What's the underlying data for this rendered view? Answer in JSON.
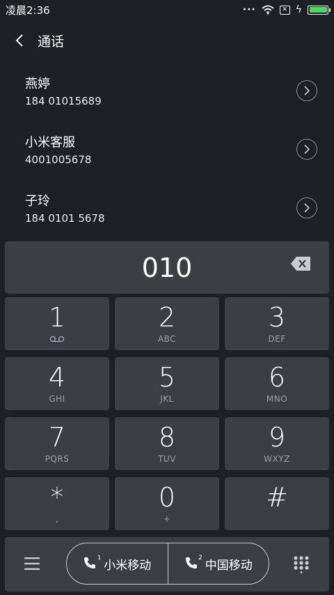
{
  "status": {
    "time": "凌晨2:36",
    "dots": "···",
    "icons": [
      "wifi-icon",
      "sim-disabled-icon",
      "charging-icon",
      "battery-icon"
    ],
    "battery_color": "#4cd964"
  },
  "header": {
    "title": "通话"
  },
  "contacts": [
    {
      "name": "燕婷",
      "number": "184 01015689"
    },
    {
      "name": "小米客服",
      "number": "4001005678"
    },
    {
      "name": "子玲",
      "number": "184 0101 5678"
    }
  ],
  "dialer": {
    "input": "010",
    "keys": [
      {
        "digit": "1",
        "letters": ""
      },
      {
        "digit": "2",
        "letters": "ABC"
      },
      {
        "digit": "3",
        "letters": "DEF"
      },
      {
        "digit": "4",
        "letters": "GHI"
      },
      {
        "digit": "5",
        "letters": "JKL"
      },
      {
        "digit": "6",
        "letters": "MNO"
      },
      {
        "digit": "7",
        "letters": "PQRS"
      },
      {
        "digit": "8",
        "letters": "TUV"
      },
      {
        "digit": "9",
        "letters": "WXYZ"
      },
      {
        "digit": "*",
        "letters": ","
      },
      {
        "digit": "0",
        "letters": "+"
      },
      {
        "digit": "#",
        "letters": ""
      }
    ]
  },
  "bottom": {
    "sim1_label": "小米移动",
    "sim2_label": "中国移动",
    "sim2_number": "2"
  },
  "colors": {
    "background": "#1d2024",
    "key_background": "#3b3e43"
  }
}
